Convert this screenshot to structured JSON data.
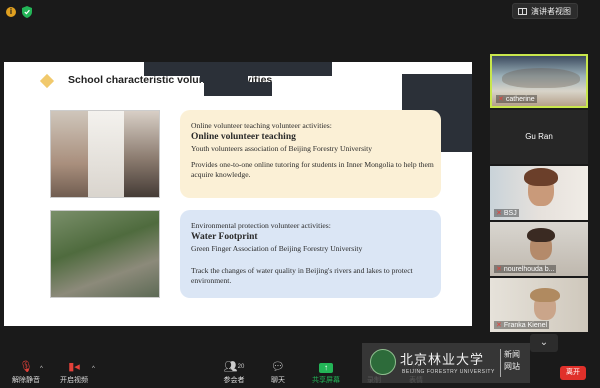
{
  "topbar": {
    "view_label": "演讲者视图"
  },
  "slide": {
    "title": "School characteristic voluntary activities",
    "cards": [
      {
        "heading": "Online volunteer teaching volunteer activities:",
        "name": "Online volunteer teaching",
        "organizer": "Youth volunteers association of Beijing Forestry University",
        "description": "Provides one-to-one online tutoring for students in Inner Mongolia to help them acquire knowledge."
      },
      {
        "heading": "Environmental protection volunteer activities:",
        "name": "Water Footprint",
        "organizer": "Green Finger Association of Beijing Forestry University",
        "description": "Track the changes of water quality in Beijing's rivers and lakes to protect environment."
      }
    ]
  },
  "participants": [
    {
      "name": "catherine",
      "muted": true
    },
    {
      "name": "Gu Ran",
      "muted": false
    },
    {
      "name": "BSJ",
      "muted": true
    },
    {
      "name": "nourelhouda b...",
      "muted": true
    },
    {
      "name": "Franka Kienel",
      "muted": true
    }
  ],
  "toolbar": {
    "mute_label": "解除静音",
    "video_label": "开启视频",
    "participants_label": "参会者",
    "participants_count": "20",
    "chat_label": "聊天",
    "share_label": "共享屏幕",
    "record_label": "录制",
    "reactions_label": "表情",
    "leave_label": "离开"
  },
  "watermark": {
    "school_name": "北京林业大学",
    "school_name_en": "BEIJING FORESTRY UNIVERSITY",
    "news_label": "新闻\n网站"
  },
  "colors": {
    "accent_green": "#23b557",
    "leave_red": "#e0302a",
    "active_border": "#c8e64c"
  }
}
